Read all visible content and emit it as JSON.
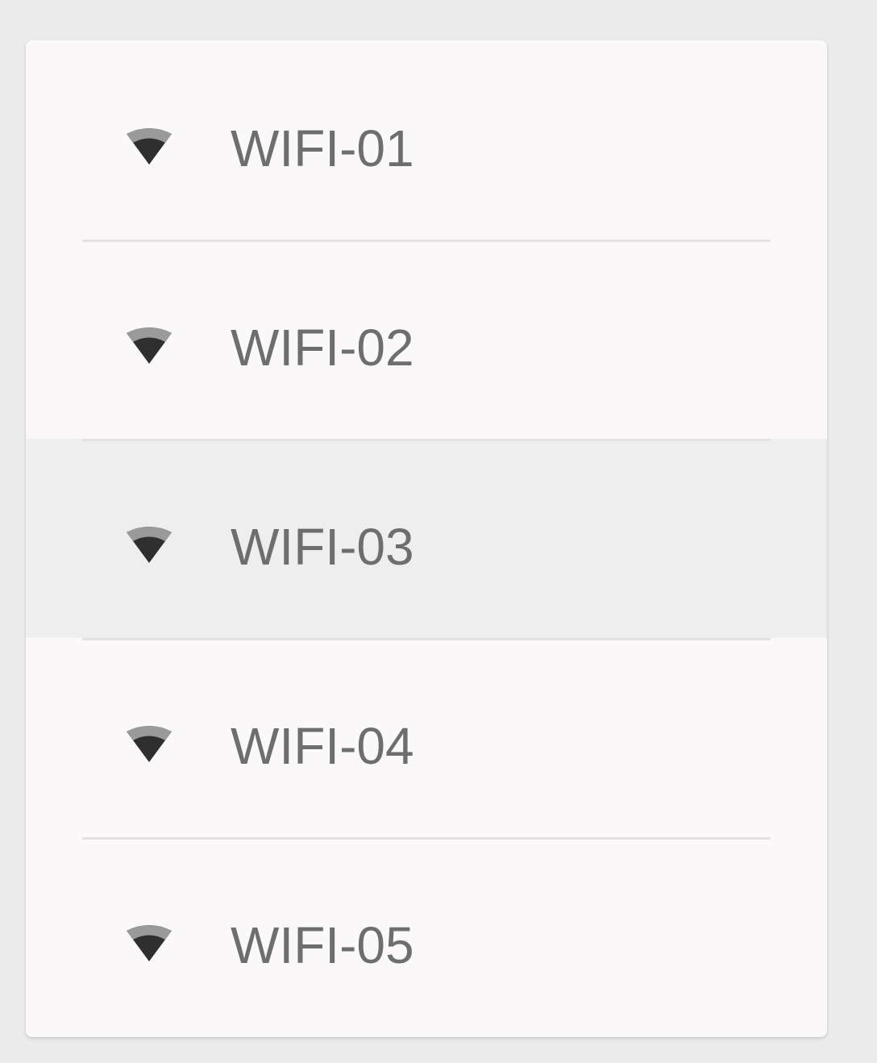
{
  "wifi_list": {
    "items": [
      {
        "label": "WIFI-01",
        "icon": "wifi-icon",
        "selected": false
      },
      {
        "label": "WIFI-02",
        "icon": "wifi-icon",
        "selected": false
      },
      {
        "label": "WIFI-03",
        "icon": "wifi-icon",
        "selected": true
      },
      {
        "label": "WIFI-04",
        "icon": "wifi-icon",
        "selected": false
      },
      {
        "label": "WIFI-05",
        "icon": "wifi-icon",
        "selected": false
      }
    ]
  },
  "colors": {
    "background": "#ececec",
    "card": "#faf8f8",
    "selected_row": "#eeeeee",
    "label_text": "#6e6e6e",
    "icon_dark": "#2f2f2f",
    "icon_light": "#9a9a9a",
    "divider": "#e4e2e2"
  }
}
